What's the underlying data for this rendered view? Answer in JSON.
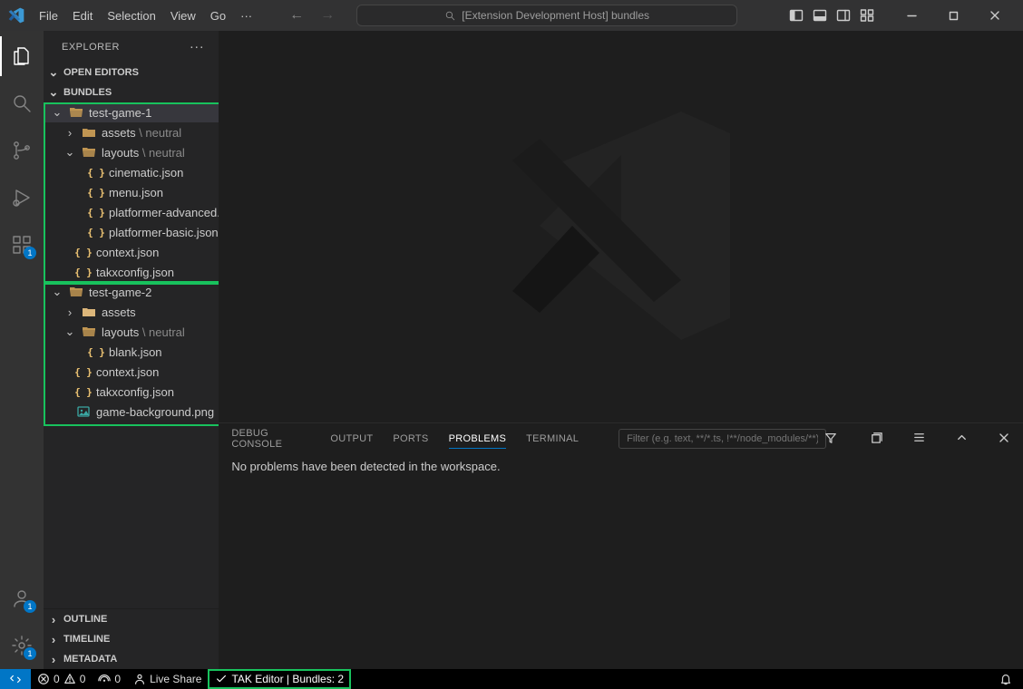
{
  "title": {
    "search_icon": "search",
    "text": "[Extension Development Host] bundles"
  },
  "menu": {
    "file": "File",
    "edit": "Edit",
    "selection": "Selection",
    "view": "View",
    "go": "Go",
    "more": "···"
  },
  "activity": {
    "explorer": "Explorer",
    "search": "Search",
    "scm": "Source Control",
    "run": "Run and Debug",
    "ext": "Extensions",
    "ext_badge": "1",
    "acct_badge": "1",
    "gear_badge": "1"
  },
  "explorer": {
    "title": "EXPLORER",
    "sections": {
      "open_editors": "OPEN EDITORS",
      "bundles": "BUNDLES",
      "outline": "OUTLINE",
      "timeline": "TIMELINE",
      "metadata": "METADATA"
    },
    "tree": {
      "game1": {
        "name": "test-game-1",
        "assets": "assets",
        "assets_suffix": " \\ neutral",
        "layouts": "layouts",
        "layouts_suffix": " \\ neutral",
        "files": {
          "cinematic": "cinematic.json",
          "menu": "menu.json",
          "padv": "platformer-advanced.json",
          "pbasic": "platformer-basic.json",
          "context": "context.json",
          "takx": "takxconfig.json"
        }
      },
      "game2": {
        "name": "test-game-2",
        "assets": "assets",
        "layouts": "layouts",
        "layouts_suffix": " \\ neutral",
        "files": {
          "blank": "blank.json",
          "context": "context.json",
          "takx": "takxconfig.json",
          "bg": "game-background.png"
        }
      }
    }
  },
  "panel": {
    "tabs": {
      "debug": "DEBUG CONSOLE",
      "output": "OUTPUT",
      "ports": "PORTS",
      "problems": "PROBLEMS",
      "terminal": "TERMINAL"
    },
    "filter_placeholder": "Filter (e.g. text, **/*.ts, !**/node_modules/**)",
    "message": "No problems have been detected in the workspace."
  },
  "status": {
    "errors": "0",
    "warnings": "0",
    "ports": "0",
    "live": "Live Share",
    "tak": "TAK Editor | Bundles: 2"
  }
}
